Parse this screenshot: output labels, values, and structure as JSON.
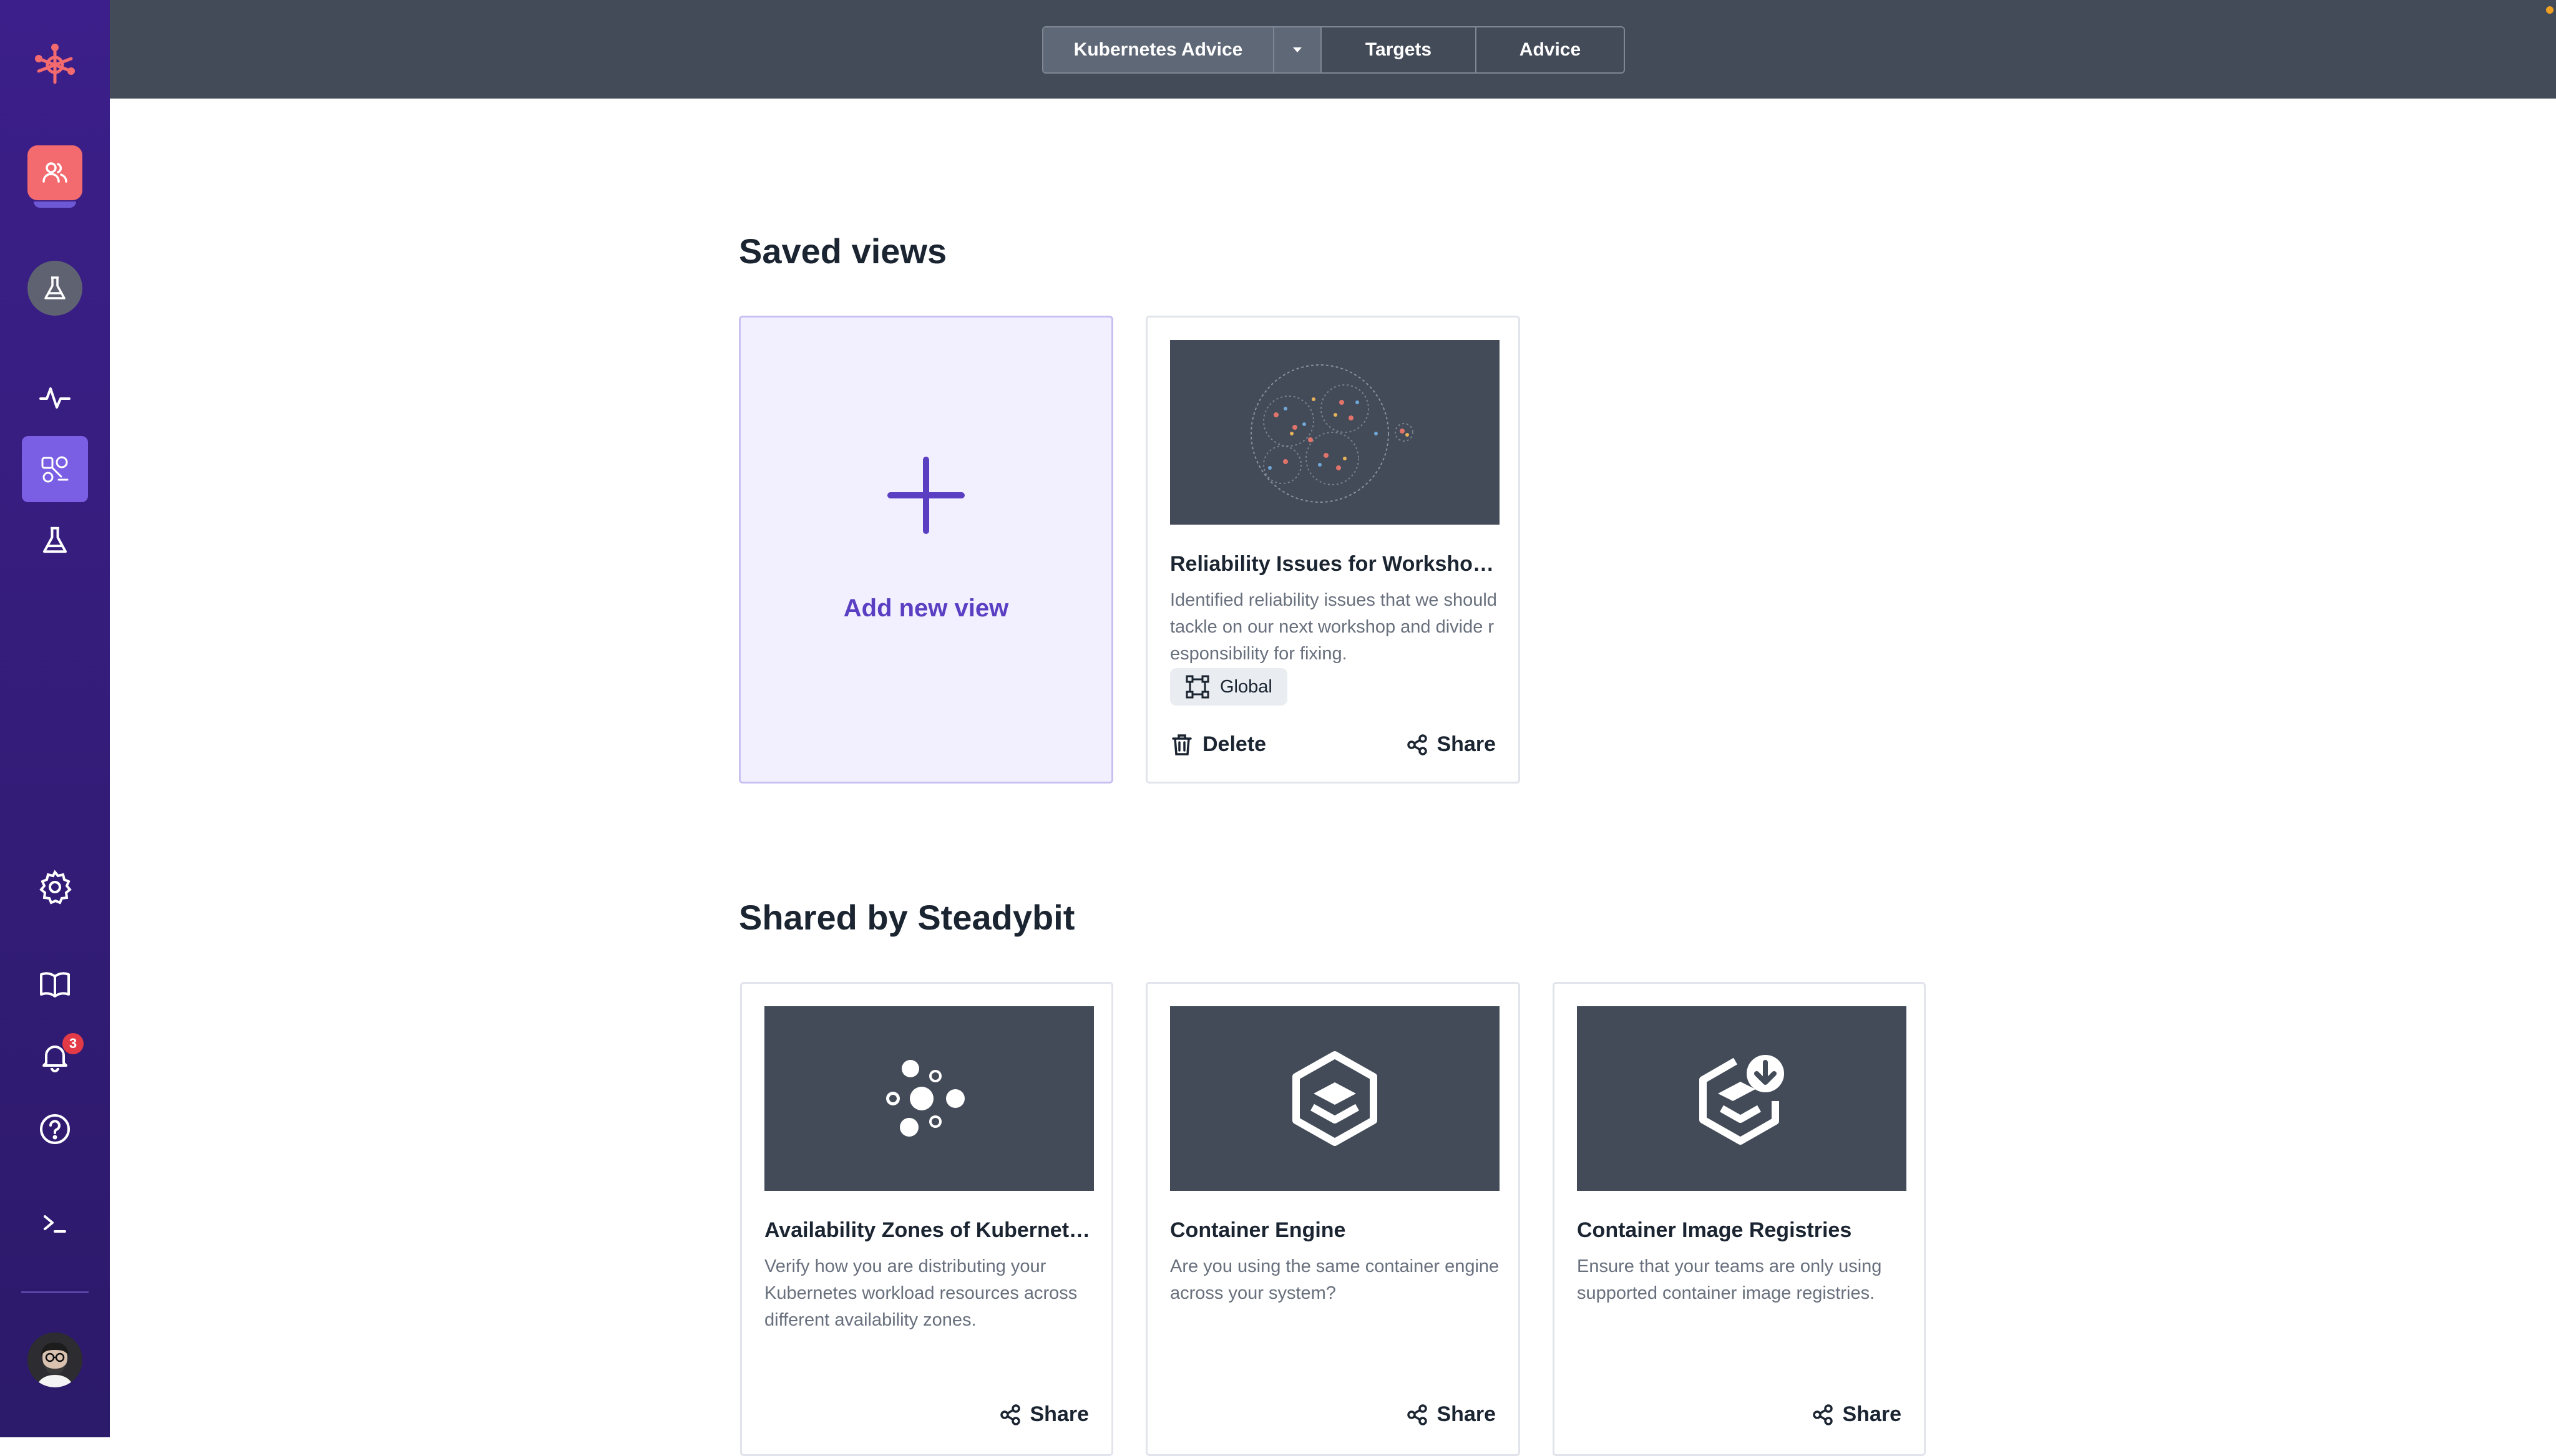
{
  "topbar": {
    "segments": {
      "active_label": "Kubernetes Advice",
      "targets_label": "Targets",
      "advice_label": "Advice"
    }
  },
  "sidebar": {
    "notifications_count": "3",
    "items": [
      {
        "name": "steadybit-logo-icon"
      },
      {
        "name": "team-icon"
      },
      {
        "name": "lab-icon"
      },
      {
        "name": "pulse-icon"
      },
      {
        "name": "explorer-icon"
      },
      {
        "name": "flask-icon"
      },
      {
        "name": "gear-icon"
      },
      {
        "name": "book-icon"
      },
      {
        "name": "bell-icon"
      },
      {
        "name": "help-icon"
      },
      {
        "name": "terminal-icon"
      },
      {
        "name": "avatar"
      }
    ]
  },
  "saved_views": {
    "heading": "Saved views",
    "add_label": "Add new view",
    "views": [
      {
        "title": "Reliability Issues for Workshop…",
        "description": "Identified reliability issues that we should tackle on our next workshop and divide responsibility for fixing.",
        "tag": "Global",
        "delete_label": "Delete",
        "share_label": "Share"
      }
    ]
  },
  "shared": {
    "heading": "Shared by Steadybit",
    "views": [
      {
        "title": "Availability Zones of Kubernet…",
        "description": "Verify how you are distributing your Kubernetes workload resources across different availability zones.",
        "share_label": "Share",
        "icon": "availability-zones-icon"
      },
      {
        "title": "Container Engine",
        "description": "Are you using the same container engine across your system?",
        "share_label": "Share",
        "icon": "container-engine-icon"
      },
      {
        "title": "Container Image Registries",
        "description": "Ensure that your teams are only using supported container image registries.",
        "share_label": "Share",
        "icon": "container-registry-icon"
      }
    ]
  },
  "colors": {
    "sidebar": "#3c1f8a",
    "topbar": "#434b58",
    "accent": "#5a3fc3",
    "team": "#f36a6f",
    "badge": "#e23b47"
  }
}
